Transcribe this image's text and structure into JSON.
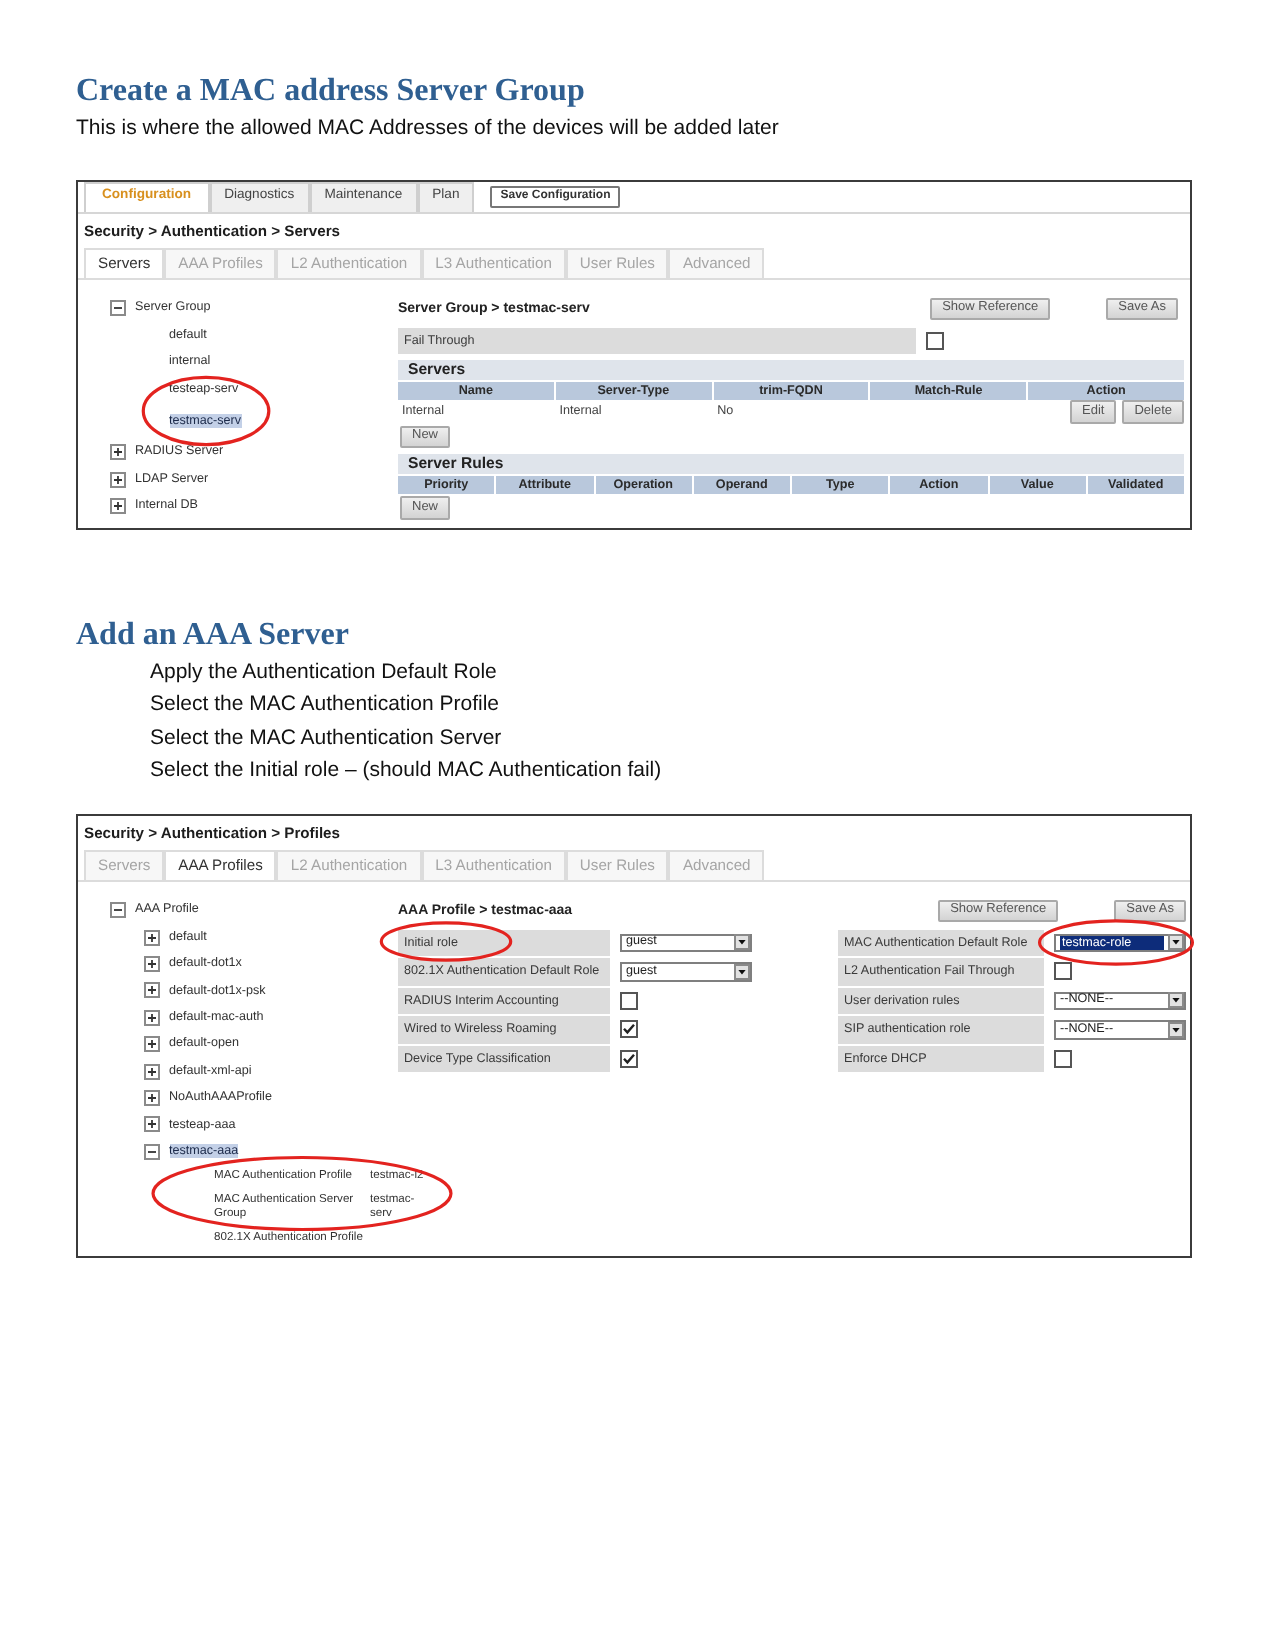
{
  "sections": [
    {
      "heading": "Create a MAC address Server Group",
      "intro": "This is where the allowed MAC Addresses of the devices will be added later",
      "screenshot": {
        "top_tabs": [
          {
            "label": "Configuration",
            "selected": true
          },
          {
            "label": "Diagnostics",
            "selected": false
          },
          {
            "label": "Maintenance",
            "selected": false
          },
          {
            "label": "Plan",
            "selected": false
          }
        ],
        "save_button": "Save Configuration",
        "breadcrumb": "Security > Authentication > Servers",
        "tabs": [
          {
            "label": "Servers",
            "selected": true
          },
          {
            "label": "AAA Profiles",
            "selected": false
          },
          {
            "label": "L2 Authentication",
            "selected": false
          },
          {
            "label": "L3 Authentication",
            "selected": false
          },
          {
            "label": "User Rules",
            "selected": false
          },
          {
            "label": "Advanced",
            "selected": false
          }
        ],
        "tree": [
          {
            "label": "Server Group",
            "expanded": true,
            "selected": false,
            "children": [
              {
                "label": "default",
                "selected": false,
                "circled": false
              },
              {
                "label": "internal",
                "selected": false,
                "circled": false
              },
              {
                "label": "testeap-serv",
                "selected": false,
                "circled": false
              },
              {
                "label": "testmac-serv",
                "selected": true,
                "circled": true
              }
            ]
          },
          {
            "label": "RADIUS Server",
            "expanded": false,
            "selected": false
          },
          {
            "label": "LDAP Server",
            "expanded": false,
            "selected": false
          },
          {
            "label": "Internal DB",
            "expanded": false,
            "selected": false
          }
        ],
        "panel": {
          "title": "Server Group > testmac-serv",
          "buttons": [
            "Show Reference",
            "Save As"
          ],
          "rows": [
            {
              "fields": [
                {
                  "kind": "checkbox",
                  "label": "Fail Through",
                  "checked": false,
                  "label_circled": false,
                  "control_circled": false
                }
              ]
            }
          ],
          "tables": [
            {
              "title": "Servers",
              "columns": [
                "Name",
                "Server-Type",
                "trim-FQDN",
                "Match-Rule",
                "Action"
              ],
              "rows": [
                {
                  "cells": [
                    "Internal",
                    "Internal",
                    "No"
                  ],
                  "actions": [
                    "Edit",
                    "Delete"
                  ]
                }
              ],
              "new_button": "New"
            },
            {
              "title": "Server Rules",
              "columns": [
                "Priority",
                "Attribute",
                "Operation",
                "Operand",
                "Type",
                "Action",
                "Value",
                "Validated"
              ],
              "new_button": "New"
            }
          ]
        }
      }
    },
    {
      "heading": "Add an AAA Server",
      "steps": [
        "Apply the Authentication Default Role",
        "Select the MAC Authentication Profile",
        "Select the MAC Authentication Server",
        "Select the Initial role – (should MAC Authentication fail)"
      ],
      "screenshot": {
        "breadcrumb": "Security > Authentication > Profiles",
        "tabs": [
          {
            "label": "Servers",
            "selected": false
          },
          {
            "label": "AAA Profiles",
            "selected": true
          },
          {
            "label": "L2 Authentication",
            "selected": false
          },
          {
            "label": "L3 Authentication",
            "selected": false
          },
          {
            "label": "User Rules",
            "selected": false
          },
          {
            "label": "Advanced",
            "selected": false
          }
        ],
        "tree": [
          {
            "label": "AAA Profile",
            "expanded": true,
            "selected": false,
            "children": [
              {
                "label": "default",
                "expanded": false,
                "selected": false
              },
              {
                "label": "default-dot1x",
                "expanded": false,
                "selected": false
              },
              {
                "label": "default-dot1x-psk",
                "expanded": false,
                "selected": false
              },
              {
                "label": "default-mac-auth",
                "expanded": false,
                "selected": false
              },
              {
                "label": "default-open",
                "expanded": false,
                "selected": false
              },
              {
                "label": "default-xml-api",
                "expanded": false,
                "selected": false
              },
              {
                "label": "NoAuthAAAProfile",
                "expanded": false,
                "selected": false
              },
              {
                "label": "testeap-aaa",
                "expanded": false,
                "selected": false
              },
              {
                "label": "testmac-aaa",
                "expanded": true,
                "selected": true,
                "properties": [
                  {
                    "label": "MAC Authentication Profile",
                    "value": "testmac-l2",
                    "circled": true
                  },
                  {
                    "label": "MAC Authentication Server Group",
                    "value": "testmac-serv",
                    "circled": true
                  },
                  {
                    "label": "802.1X Authentication Profile",
                    "circled": false
                  }
                ]
              }
            ]
          }
        ],
        "panel": {
          "title": "AAA Profile > testmac-aaa",
          "buttons": [
            "Show Reference",
            "Save As"
          ],
          "rows": [
            {
              "fields": [
                {
                  "kind": "select",
                  "label": "Initial role",
                  "value": "guest",
                  "highlighted": false,
                  "label_circled": true,
                  "control_circled": false
                },
                {
                  "kind": "select",
                  "label": "MAC Authentication Default Role",
                  "value": "testmac-role",
                  "highlighted": true,
                  "label_circled": false,
                  "control_circled": true
                }
              ]
            },
            {
              "fields": [
                {
                  "kind": "select",
                  "label": "802.1X Authentication Default Role",
                  "value": "guest",
                  "highlighted": false,
                  "label_circled": false,
                  "control_circled": false
                },
                {
                  "kind": "checkbox",
                  "label": "L2 Authentication Fail Through",
                  "checked": false,
                  "label_circled": false,
                  "control_circled": false
                }
              ]
            },
            {
              "fields": [
                {
                  "kind": "checkbox",
                  "label": "RADIUS Interim Accounting",
                  "checked": false,
                  "label_circled": false,
                  "control_circled": false
                },
                {
                  "kind": "select",
                  "label": "User derivation rules",
                  "value": "--NONE--",
                  "highlighted": false,
                  "label_circled": false,
                  "control_circled": false
                }
              ]
            },
            {
              "fields": [
                {
                  "kind": "checkbox",
                  "label": "Wired to Wireless Roaming",
                  "checked": true,
                  "label_circled": false,
                  "control_circled": false
                },
                {
                  "kind": "select",
                  "label": "SIP authentication role",
                  "value": "--NONE--",
                  "highlighted": false,
                  "label_circled": false,
                  "control_circled": false
                }
              ]
            },
            {
              "fields": [
                {
                  "kind": "checkbox",
                  "label": "Device Type Classification",
                  "checked": true,
                  "label_circled": false,
                  "control_circled": false
                },
                {
                  "kind": "checkbox",
                  "label": "Enforce DHCP",
                  "checked": false,
                  "label_circled": false,
                  "control_circled": false
                }
              ]
            }
          ]
        }
      }
    }
  ]
}
